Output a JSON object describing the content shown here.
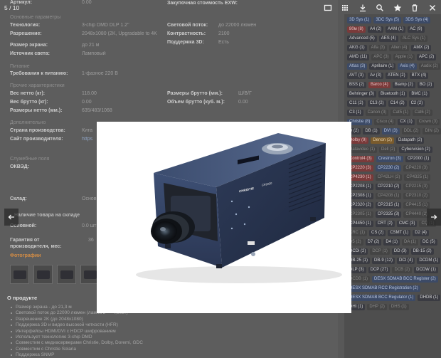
{
  "lightbox": {
    "counter": "5 / 10",
    "tools": [
      {
        "name": "fullscreen-icon"
      },
      {
        "name": "thumbnails-icon"
      },
      {
        "name": "download-icon"
      },
      {
        "name": "zoom-icon"
      },
      {
        "name": "star-icon"
      },
      {
        "name": "trash-icon"
      },
      {
        "name": "close-icon"
      }
    ],
    "product_badge": "CHRISTIE",
    "model_badge": "CP2220"
  },
  "page": {
    "sections": {
      "main_params": "Основные параметры",
      "power": "Питание",
      "other": "Прочие характеристики",
      "extra": "Дополнительно",
      "service": "Служебные поля",
      "stock": "Наличие товара на складе"
    },
    "specs": {
      "tech_label": "Технология:",
      "tech_value": "3-chip DMD DLP 1.2\"",
      "res_label": "Разрешение:",
      "res_value": "2048x1080 (2K, Upgradable to 4K",
      "screen_label": "Размер экрана:",
      "screen_value": "до 21 м",
      "light_label": "Источник света:",
      "light_value": "Ламповый",
      "flux_label": "Световой поток:",
      "flux_value": "до 22000 люмен",
      "contrast_label": "Контрастность:",
      "contrast_value": "2100",
      "support3d_label": "Поддержка 3D:",
      "support3d_value": "Есть",
      "power_label": "Требования к питанию:",
      "power_value": "1-фазное 220 В",
      "net_label": "Вес нетто (кг):",
      "net_value": "118.00",
      "gross_label": "Вес брутто (кг):",
      "gross_value": "0.00",
      "dim_net_label": "Размеры нетто (мм.):",
      "dim_net_value": "635/483/1068",
      "dim_gross_label": "Размеры брутто (мм.):",
      "dim_gross_value": "Ш/В/Г",
      "vol_label": "Объем брутто (куб. м.):",
      "vol_value": "0.00",
      "country_label": "Страна производства:",
      "country_value": "Кита",
      "site_label": "Сайт производителя:",
      "site_value": "https",
      "okved_label": "ОКВЭД:",
      "warehouse_label": "Склад:",
      "warehouse_value": "Основ",
      "main_label": "Основной:",
      "main_value": "0.0 шт",
      "warranty_label": "Гарантия от производителя, мес:",
      "warranty_value": "36",
      "purchase_label": "Закупочная стоимость EXW:",
      "top_cut_label": "Артикул:",
      "top_cut_value": "0.00"
    },
    "photos_link": "Фотографии",
    "about_title": "О продукте",
    "bullets": [
      "Размер экрана - до 21,3 м",
      "Световой поток до 22000 люмен (лампа 2 — 4,5кВт)",
      "Разрешение 2K (до 2048x1080)",
      "Поддержка 3D и видео высокой четкости (HFR)",
      "Интерфейсы HDMI/DVI с HDCP шифрованием",
      "Использует технологию 3-chip DMD",
      "Совместим с медиасерверами Christie, Dolby, Doremi, GDC",
      "Совместим с Christie Solaria",
      "Поддержка SNMP"
    ]
  },
  "tags": [
    {
      "t": "3D Sys (1)",
      "k": "b"
    },
    {
      "t": "3DC Sys (5)",
      "k": "b"
    },
    {
      "t": "3DS Sys (4)",
      "k": "b"
    },
    {
      "t": "80м (8)",
      "k": "r"
    },
    {
      "t": "A4 (2)",
      "k": ""
    },
    {
      "t": "AAM (1)",
      "k": ""
    },
    {
      "t": "AC (9)",
      "k": ""
    },
    {
      "t": "Advanced (5)",
      "k": ""
    },
    {
      "t": "AES (4)",
      "k": ""
    },
    {
      "t": "ALC Sys (1)",
      "k": "f"
    },
    {
      "t": "AKG (1)",
      "k": ""
    },
    {
      "t": "Alfa (3)",
      "k": "f"
    },
    {
      "t": "Allen (4)",
      "k": "f"
    },
    {
      "t": "AMX (2)",
      "k": ""
    },
    {
      "t": "AMD (11)",
      "k": ""
    },
    {
      "t": "APC (3)",
      "k": "f"
    },
    {
      "t": "Apple (1)",
      "k": "f"
    },
    {
      "t": "APC (2)",
      "k": ""
    },
    {
      "t": "Atlas (3)",
      "k": "b"
    },
    {
      "t": "Aprilaire (1)",
      "k": ""
    },
    {
      "t": "Axis (4)",
      "k": "b"
    },
    {
      "t": "Audix (2)",
      "k": "f"
    },
    {
      "t": "AVT (3)",
      "k": ""
    },
    {
      "t": "Av (3)",
      "k": ""
    },
    {
      "t": "ATEN (2)",
      "k": ""
    },
    {
      "t": "BTX (4)",
      "k": ""
    },
    {
      "t": "BSS (2)",
      "k": ""
    },
    {
      "t": "Barco (4)",
      "k": "r"
    },
    {
      "t": "Biamp (2)",
      "k": ""
    },
    {
      "t": "BO (2)",
      "k": ""
    },
    {
      "t": "Behringer (3)",
      "k": ""
    },
    {
      "t": "Bluetooth (1)",
      "k": ""
    },
    {
      "t": "BMC (1)",
      "k": ""
    },
    {
      "t": "C11 (2)",
      "k": ""
    },
    {
      "t": "C13 (2)",
      "k": ""
    },
    {
      "t": "C14 (2)",
      "k": ""
    },
    {
      "t": "C2 (2)",
      "k": ""
    },
    {
      "t": "C3 (1)",
      "k": ""
    },
    {
      "t": "Canon (3)",
      "k": "f"
    },
    {
      "t": "Cat5 (1)",
      "k": "f"
    },
    {
      "t": "Cat6 (2)",
      "k": "f"
    },
    {
      "t": "Christie (8)",
      "k": "b"
    },
    {
      "t": "Cisco (4)",
      "k": "f"
    },
    {
      "t": "CX (1)",
      "k": ""
    },
    {
      "t": "Crown (3)",
      "k": "f"
    },
    {
      "t": "D (2)",
      "k": ""
    },
    {
      "t": "DB (1)",
      "k": ""
    },
    {
      "t": "DVI (3)",
      "k": "b"
    },
    {
      "t": "DDL (2)",
      "k": "f"
    },
    {
      "t": "DIN (2)",
      "k": "f"
    },
    {
      "t": "Dolby (9)",
      "k": "r"
    },
    {
      "t": "Denon (2)",
      "k": "o"
    },
    {
      "t": "Datapath (2)",
      "k": ""
    },
    {
      "t": "Datavideo (1)",
      "k": "f"
    },
    {
      "t": "Dell (2)",
      "k": "f"
    },
    {
      "t": "Cybervision (2)",
      "k": ""
    },
    {
      "t": "Control4 (3)",
      "k": "r"
    },
    {
      "t": "Crestron (3)",
      "k": "b"
    },
    {
      "t": "CP2000 (1)",
      "k": ""
    },
    {
      "t": "CP2220 (3)",
      "k": "r"
    },
    {
      "t": "CP2230 (2)",
      "k": "b"
    },
    {
      "t": "CP4220 (3)",
      "k": "f"
    },
    {
      "t": "CP4230 (1)",
      "k": "r"
    },
    {
      "t": "CP42LH (2)",
      "k": "f"
    },
    {
      "t": "CP4325 (1)",
      "k": "f"
    },
    {
      "t": "CP2208 (1)",
      "k": ""
    },
    {
      "t": "CP2210 (2)",
      "k": ""
    },
    {
      "t": "CP2215 (3)",
      "k": "f"
    },
    {
      "t": "CP2308 (1)",
      "k": ""
    },
    {
      "t": "CP4208 (1)",
      "k": "f"
    },
    {
      "t": "CP2310 (2)",
      "k": "f"
    },
    {
      "t": "CP2320 (2)",
      "k": ""
    },
    {
      "t": "CP2315 (1)",
      "k": ""
    },
    {
      "t": "CP4415 (1)",
      "k": "f"
    },
    {
      "t": "CP2305 (1)",
      "k": "f"
    },
    {
      "t": "CP2325 (3)",
      "k": ""
    },
    {
      "t": "CP4440 (2)",
      "k": "f"
    },
    {
      "t": "CP4450 (1)",
      "k": ""
    },
    {
      "t": "CRT (2)",
      "k": ""
    },
    {
      "t": "CMC (3)",
      "k": ""
    },
    {
      "t": "CQ (1)",
      "k": "f"
    },
    {
      "t": "CRC (1)",
      "k": "f"
    },
    {
      "t": "CS (2)",
      "k": ""
    },
    {
      "t": "CSMT (1)",
      "k": ""
    },
    {
      "t": "D2 (4)",
      "k": ""
    },
    {
      "t": "D5 (2)",
      "k": "f"
    },
    {
      "t": "D7 (2)",
      "k": ""
    },
    {
      "t": "D4 (1)",
      "k": ""
    },
    {
      "t": "DA (1)",
      "k": "f"
    },
    {
      "t": "DC (5)",
      "k": ""
    },
    {
      "t": "DCDi (2)",
      "k": ""
    },
    {
      "t": "DCP (1)",
      "k": "f"
    },
    {
      "t": "DD (3)",
      "k": ""
    },
    {
      "t": "DB-15 (2)",
      "k": ""
    },
    {
      "t": "DB-25 (1)",
      "k": ""
    },
    {
      "t": "DB-9 (12)",
      "k": ""
    },
    {
      "t": "DCI (4)",
      "k": ""
    },
    {
      "t": "DCDM (1)",
      "k": ""
    },
    {
      "t": "DLP (3)",
      "k": ""
    },
    {
      "t": "DCP (27)",
      "k": ""
    },
    {
      "t": "DCB (2)",
      "k": "f"
    },
    {
      "t": "DCDW (1)",
      "k": ""
    },
    {
      "t": "DCDB (1)",
      "k": "f"
    },
    {
      "t": "DESX SDMAB BCC Register (2)",
      "k": "b"
    },
    {
      "t": "DESX SDMAB RCC Registration (2)",
      "k": "b"
    },
    {
      "t": "DESX SDMAB BCC Regulator (1)",
      "k": "b"
    },
    {
      "t": "DHDB (1)",
      "k": ""
    },
    {
      "t": "DHI (1)",
      "k": ""
    },
    {
      "t": "DHP (2)",
      "k": "f"
    },
    {
      "t": "DHS (1)",
      "k": "f"
    }
  ]
}
